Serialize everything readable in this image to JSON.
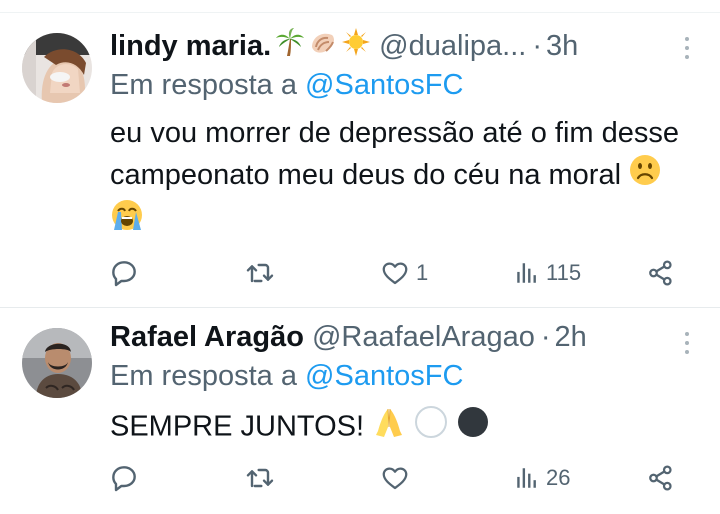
{
  "colors": {
    "accent": "#1d9bf0",
    "text": "#0f1419",
    "muted": "#536471",
    "divider": "#eff3f4"
  },
  "tweets": [
    {
      "name": "lindy maria.",
      "name_emojis": [
        "palm-tree-emoji",
        "shell-emoji",
        "sun-emoji"
      ],
      "handle": "@dualipa...",
      "separator": "·",
      "time": "3h",
      "reply_prefix": "Em resposta a",
      "reply_mention": "@SantosFC",
      "text": "eu vou morrer de depressão até o fim desse campeonato meu deus do céu na moral",
      "text_emojis": [
        "frowning-face-emoji",
        "loudly-crying-face-emoji"
      ],
      "reply_count": "",
      "retweet_count": "",
      "like_count": "1",
      "view_count": "115",
      "icons": [
        "reply-icon",
        "retweet-icon",
        "like-icon",
        "views-icon",
        "share-icon",
        "more-icon"
      ]
    },
    {
      "name": "Rafael Aragão",
      "handle": "@RaafaelAragao",
      "separator": "·",
      "time": "2h",
      "reply_prefix": "Em resposta a",
      "reply_mention": "@SantosFC",
      "text": "SEMPRE JUNTOS!",
      "text_emojis": [
        "folded-hands-emoji",
        "white-circle-emoji",
        "black-circle-emoji"
      ],
      "reply_count": "",
      "retweet_count": "",
      "like_count": "",
      "view_count": "26",
      "icons": [
        "reply-icon",
        "retweet-icon",
        "like-icon",
        "views-icon",
        "share-icon",
        "more-icon"
      ]
    }
  ]
}
